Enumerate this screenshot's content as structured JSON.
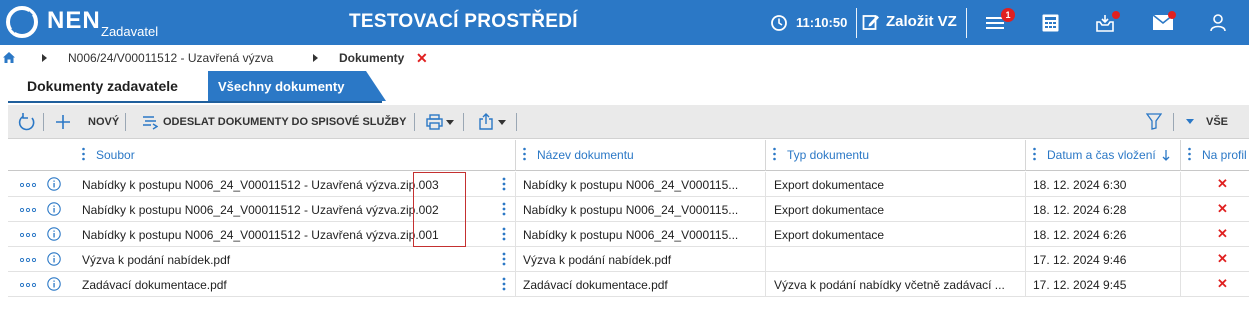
{
  "header": {
    "logo": "NEN",
    "logo_sub": "Zadavatel",
    "environment": "TESTOVACÍ PROSTŘEDÍ",
    "clock": "11:10:50",
    "create_label": "Založit VZ",
    "menu_badge": "1",
    "colors": {
      "bar": "#2b78c6",
      "badge": "#e02020"
    }
  },
  "breadcrumb": {
    "items": [
      "N006/24/V00011512 - Uzavřená výzva",
      "Dokumenty"
    ],
    "close_symbol": "✕"
  },
  "tabs": {
    "active": "Dokumenty zadavatele",
    "other": "Všechny dokumenty"
  },
  "toolbar": {
    "new_label": "NOVÝ",
    "send_label": "ODESLAT DOKUMENTY DO SPISOVÉ SLUŽBY",
    "all_label": "VŠE"
  },
  "table": {
    "columns": [
      "Soubor",
      "Název dokumentu",
      "Typ dokumentu",
      "Datum a čas vložení",
      "Na profil"
    ],
    "rows": [
      {
        "file": "Nabídky k postupu N006_24_V00011512 - Uzavřená výzva.zip.003",
        "name": "Nabídky k postupu N006_24_V000115...",
        "type": "Export dokumentace",
        "date": "18. 12. 2024 6:30",
        "profile": "✕"
      },
      {
        "file": "Nabídky k postupu N006_24_V00011512 - Uzavřená výzva.zip.002",
        "name": "Nabídky k postupu N006_24_V000115...",
        "type": "Export dokumentace",
        "date": "18. 12. 2024 6:28",
        "profile": "✕"
      },
      {
        "file": "Nabídky k postupu N006_24_V00011512 - Uzavřená výzva.zip.001",
        "name": "Nabídky k postupu N006_24_V000115...",
        "type": "Export dokumentace",
        "date": "18. 12. 2024 6:26",
        "profile": "✕"
      },
      {
        "file": "Výzva k podání nabídek.pdf",
        "name": "Výzva k podání nabídek.pdf",
        "type": "",
        "date": "17. 12. 2024 9:46",
        "profile": "✕"
      },
      {
        "file": "Zadávací dokumentace.pdf",
        "name": "Zadávací dokumentace.pdf",
        "type": "Výzva k podání nabídky včetně zadávací ...",
        "date": "17. 12. 2024 9:45",
        "profile": "✕"
      }
    ]
  }
}
